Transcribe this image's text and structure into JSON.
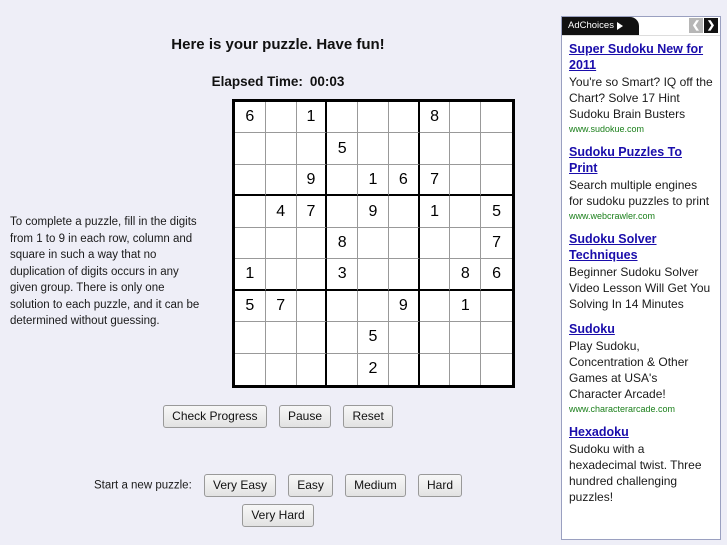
{
  "instructions": {
    "text": "To complete a puzzle, fill in the digits from 1 to 9 in each row, column and square in such a way that no duplication of digits occurs in any given group. There is only one solution to each puzzle, and it can be determined without guessing."
  },
  "puzzle": {
    "title": "Here is your puzzle. Have fun!",
    "timer_label": "Elapsed Time:",
    "timer_value": "00:03",
    "grid": [
      [
        "6",
        "",
        "1",
        "",
        "",
        "",
        "8",
        "",
        ""
      ],
      [
        "",
        "",
        "",
        "5",
        "",
        "",
        "",
        "",
        ""
      ],
      [
        "",
        "",
        "9",
        "",
        "1",
        "6",
        "7",
        "",
        ""
      ],
      [
        "",
        "4",
        "7",
        "",
        "9",
        "",
        "1",
        "",
        "5"
      ],
      [
        "",
        "",
        "",
        "8",
        "",
        "",
        "",
        "",
        "7"
      ],
      [
        "1",
        "",
        "",
        "3",
        "",
        "",
        "",
        "8",
        "6"
      ],
      [
        "5",
        "7",
        "",
        "",
        "",
        "9",
        "",
        "1",
        ""
      ],
      [
        "",
        "",
        "",
        "",
        "5",
        "",
        "",
        "",
        ""
      ],
      [
        "",
        "",
        "",
        "",
        "2",
        "",
        "",
        "",
        ""
      ]
    ]
  },
  "controls": {
    "check_progress": "Check Progress",
    "pause": "Pause",
    "reset": "Reset"
  },
  "new_puzzle": {
    "label": "Start a new puzzle:",
    "very_easy": "Very Easy",
    "easy": "Easy",
    "medium": "Medium",
    "hard": "Hard",
    "very_hard": "Very Hard"
  },
  "ads": {
    "header": {
      "adchoices_label": "AdChoices",
      "prev_glyph": "❮",
      "next_glyph": "❯"
    },
    "items": [
      {
        "title": "Super Sudoku New for 2011",
        "desc": "You're so Smart? IQ off the Chart? Solve 17 Hint Sudoku Brain Busters",
        "url": "www.sudokue.com"
      },
      {
        "title": "Sudoku Puzzles To Print",
        "desc": "Search multiple engines for sudoku puzzles to print",
        "url": "www.webcrawler.com"
      },
      {
        "title": "Sudoku Solver Techniques",
        "desc": "Beginner Sudoku Solver Video Lesson Will Get You Solving In 14 Minutes",
        "url": ""
      },
      {
        "title": "Sudoku",
        "desc": "Play Sudoku, Concentration & Other Games at USA's Character Arcade!",
        "url": "www.characterarcade.com"
      },
      {
        "title": "Hexadoku",
        "desc": "Sudoku with a hexadecimal twist. Three hundred challenging puzzles!",
        "url": ""
      }
    ]
  },
  "colors": {
    "page_bg": "#eeeef7",
    "ad_link": "#1a0dab",
    "ad_url": "#1a7f1a"
  }
}
